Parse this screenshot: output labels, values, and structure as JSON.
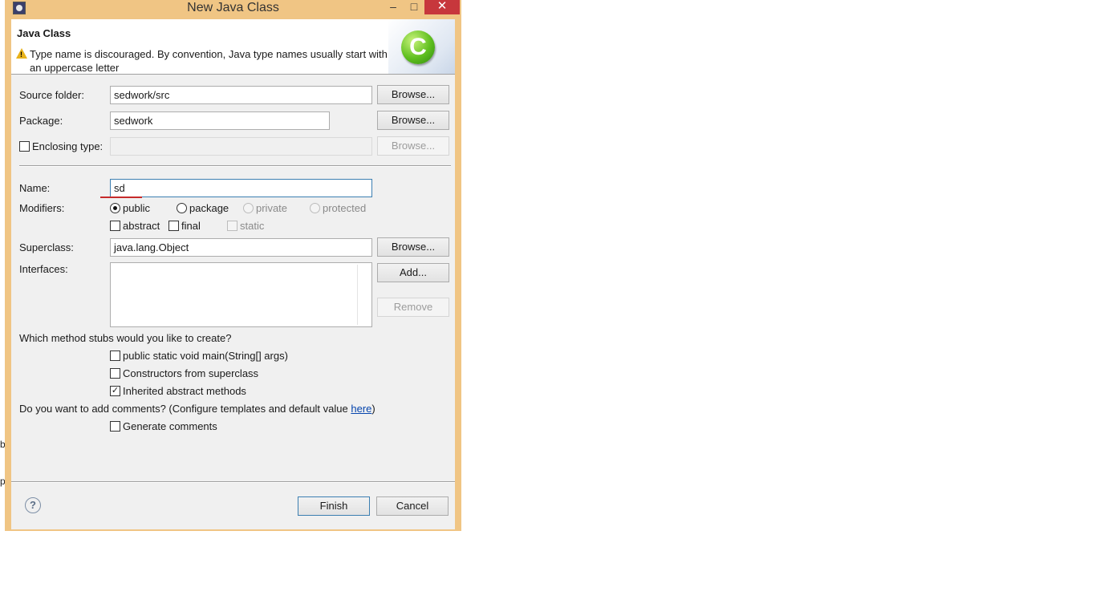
{
  "background": {
    "fragments": [
      "b",
      "p"
    ]
  },
  "window": {
    "title": "New Java Class",
    "controls": {
      "minimize": "–",
      "maximize": "□",
      "close": "✕"
    }
  },
  "banner": {
    "title": "Java Class",
    "message": "Type name is discouraged. By convention, Java type names usually start with an uppercase letter",
    "icon": "class-c-icon"
  },
  "form": {
    "source_folder": {
      "label": "Source folder:",
      "value": "sedwork/src",
      "button": "Browse..."
    },
    "package": {
      "label": "Package:",
      "value": "sedwork",
      "button": "Browse..."
    },
    "enclosing_type": {
      "label": "Enclosing type:",
      "value": "",
      "checked": false,
      "button": "Browse..."
    },
    "name": {
      "label": "Name:",
      "value": "sd"
    },
    "modifiers": {
      "label": "Modifiers:",
      "radios": [
        {
          "label": "public",
          "selected": true,
          "enabled": true
        },
        {
          "label": "package",
          "selected": false,
          "enabled": true
        },
        {
          "label": "private",
          "selected": false,
          "enabled": false
        },
        {
          "label": "protected",
          "selected": false,
          "enabled": false
        }
      ],
      "checks": [
        {
          "label": "abstract",
          "checked": false,
          "enabled": true
        },
        {
          "label": "final",
          "checked": false,
          "enabled": true
        },
        {
          "label": "static",
          "checked": false,
          "enabled": false
        }
      ]
    },
    "superclass": {
      "label": "Superclass:",
      "value": "java.lang.Object",
      "button": "Browse..."
    },
    "interfaces": {
      "label": "Interfaces:",
      "items": [],
      "add_button": "Add...",
      "remove_button": "Remove"
    },
    "stubs": {
      "question": "Which method stubs would you like to create?",
      "options": [
        {
          "label": "public static void main(String[] args)",
          "checked": false
        },
        {
          "label": "Constructors from superclass",
          "checked": false
        },
        {
          "label": "Inherited abstract methods",
          "checked": true
        }
      ]
    },
    "comments": {
      "question_prefix": "Do you want to add comments? (Configure templates and default value ",
      "link": "here",
      "question_suffix": ")",
      "option": {
        "label": "Generate comments",
        "checked": false
      }
    }
  },
  "footer": {
    "help": "?",
    "finish": "Finish",
    "cancel": "Cancel"
  },
  "colors": {
    "window_frame": "#f0c584",
    "close_button": "#c7373c",
    "dialog_bg": "#f0f0f0",
    "warning": "#e8b21a",
    "spell_underline": "#c62a2a"
  }
}
